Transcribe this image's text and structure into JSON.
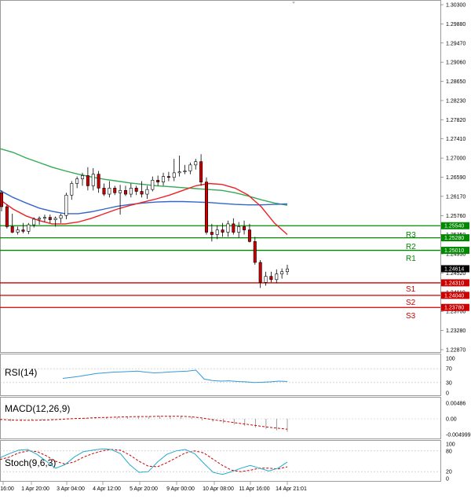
{
  "chart_data": {
    "type": "candlestick",
    "instrument_note": "",
    "colors": {
      "bull": "#ffffff",
      "bear": "#cc0000",
      "wick": "#000000",
      "ma_fast": "#3366cc",
      "ma_slow": "#33aa55",
      "ma_red": "#ee2222",
      "support": "#cc0000",
      "resistance": "#008800",
      "current": "#000000",
      "rsi": "#3399dd",
      "macd": "#cc0000",
      "stoch_main": "#22aacc",
      "stoch_signal": "#cc0000"
    },
    "price_axis": {
      "min": 1.2287,
      "max": 1.303,
      "labels": [
        "1.30300",
        "1.29880",
        "1.29470",
        "1.29060",
        "1.28650",
        "1.28230",
        "1.27820",
        "1.27410",
        "1.27000",
        "1.26590",
        "1.26170",
        "1.25760",
        "1.25350",
        "1.24930",
        "1.24520",
        "1.24110",
        "1.23700",
        "1.23280",
        "1.22870"
      ]
    },
    "time_axis": {
      "labels": [
        "16:00",
        "1 Apr 20:00",
        "3 Apr 04:00",
        "4 Apr 12:00",
        "5 Apr 20:00",
        "9 Apr 00:00",
        "10 Apr 08:00",
        "11 Apr 16:00",
        "14 Apr 21:01"
      ]
    },
    "candles": [
      [
        1.2625,
        1.263,
        1.2585,
        1.2595
      ],
      [
        1.2595,
        1.26,
        1.2548,
        1.2552
      ],
      [
        1.2552,
        1.258,
        1.2538,
        1.254
      ],
      [
        1.254,
        1.2552,
        1.2535,
        1.2545
      ],
      [
        1.2545,
        1.256,
        1.2538,
        1.2542
      ],
      [
        1.2542,
        1.256,
        1.2536,
        1.2556
      ],
      [
        1.2556,
        1.2572,
        1.255,
        1.2568
      ],
      [
        1.2568,
        1.2574,
        1.2556,
        1.257
      ],
      [
        1.257,
        1.2578,
        1.2562,
        1.2572
      ],
      [
        1.2572,
        1.2578,
        1.256,
        1.2567
      ],
      [
        1.2567,
        1.2574,
        1.2552,
        1.257
      ],
      [
        1.257,
        1.258,
        1.256,
        1.2576
      ],
      [
        1.2576,
        1.2625,
        1.2568,
        1.262
      ],
      [
        1.262,
        1.265,
        1.261,
        1.2645
      ],
      [
        1.2645,
        1.266,
        1.2635,
        1.2655
      ],
      [
        1.2655,
        1.2668,
        1.264,
        1.2662
      ],
      [
        1.2662,
        1.268,
        1.263,
        1.264
      ],
      [
        1.264,
        1.2678,
        1.263,
        1.2665
      ],
      [
        1.2665,
        1.2672,
        1.2625,
        1.2635
      ],
      [
        1.2635,
        1.2645,
        1.2618,
        1.2622
      ],
      [
        1.2622,
        1.265,
        1.2615,
        1.2635
      ],
      [
        1.2635,
        1.264,
        1.262,
        1.2625
      ],
      [
        1.2625,
        1.2642,
        1.2578,
        1.263
      ],
      [
        1.263,
        1.264,
        1.2618,
        1.2622
      ],
      [
        1.2622,
        1.2645,
        1.2615,
        1.2635
      ],
      [
        1.2635,
        1.264,
        1.262,
        1.2628
      ],
      [
        1.2628,
        1.265,
        1.2615,
        1.2622
      ],
      [
        1.2622,
        1.264,
        1.2612,
        1.2632
      ],
      [
        1.2632,
        1.266,
        1.2628,
        1.2652
      ],
      [
        1.2652,
        1.2662,
        1.264,
        1.2648
      ],
      [
        1.2648,
        1.2668,
        1.264,
        1.266
      ],
      [
        1.266,
        1.267,
        1.265,
        1.2658
      ],
      [
        1.2658,
        1.2698,
        1.265,
        1.2668
      ],
      [
        1.2668,
        1.2705,
        1.266,
        1.267
      ],
      [
        1.267,
        1.2685,
        1.2665,
        1.2672
      ],
      [
        1.2672,
        1.269,
        1.2665,
        1.2685
      ],
      [
        1.2685,
        1.2698,
        1.2675,
        1.2692
      ],
      [
        1.2692,
        1.2708,
        1.264,
        1.2648
      ],
      [
        1.2648,
        1.2658,
        1.2535,
        1.254
      ],
      [
        1.254,
        1.2558,
        1.252,
        1.2535
      ],
      [
        1.2535,
        1.2555,
        1.2525,
        1.2545
      ],
      [
        1.2545,
        1.256,
        1.253,
        1.254
      ],
      [
        1.254,
        1.2565,
        1.253,
        1.2558
      ],
      [
        1.2558,
        1.257,
        1.2535,
        1.254
      ],
      [
        1.254,
        1.2562,
        1.2528,
        1.2552
      ],
      [
        1.2552,
        1.2565,
        1.2535,
        1.2545
      ],
      [
        1.2545,
        1.2558,
        1.2518,
        1.252
      ],
      [
        1.252,
        1.253,
        1.247,
        1.2475
      ],
      [
        1.2475,
        1.248,
        1.242,
        1.2432
      ],
      [
        1.2432,
        1.2455,
        1.2425,
        1.2445
      ],
      [
        1.2445,
        1.2455,
        1.2432,
        1.2438
      ],
      [
        1.2438,
        1.246,
        1.243,
        1.245
      ],
      [
        1.245,
        1.2462,
        1.244,
        1.2455
      ],
      [
        1.2455,
        1.247,
        1.2448,
        1.2461
      ]
    ],
    "ma_fast": [
      1.263,
      1.2615,
      1.2603,
      1.2592,
      1.2585,
      1.258,
      1.258,
      1.2584,
      1.259,
      1.2596,
      1.26,
      1.2603,
      1.2605,
      1.2606,
      1.2606,
      1.2605,
      1.2604,
      1.2602,
      1.26,
      1.2599,
      1.2599,
      1.26,
      1.2601
    ],
    "ma_slow": [
      1.272,
      1.2712,
      1.27,
      1.269,
      1.268,
      1.2672,
      1.2665,
      1.2659,
      1.2654,
      1.265,
      1.2646,
      1.2643,
      1.264,
      1.2638,
      1.2636,
      1.2634,
      1.2632,
      1.263,
      1.2625,
      1.2618,
      1.261,
      1.2603,
      1.2598
    ],
    "ma_red": [
      1.261,
      1.259,
      1.2575,
      1.2565,
      1.2558,
      1.2558,
      1.2562,
      1.257,
      1.258,
      1.259,
      1.2598,
      1.2605,
      1.2612,
      1.262,
      1.263,
      1.264,
      1.2645,
      1.2643,
      1.2635,
      1.262,
      1.2595,
      1.256,
      1.2535
    ],
    "levels": [
      {
        "name": "R3",
        "value": 1.2554,
        "type": "resistance",
        "label": "1.25540",
        "show_name": false
      },
      {
        "name": "R3",
        "value": 1.2528,
        "type": "resistance",
        "label": "1.25280",
        "show_name": true
      },
      {
        "name": "R2",
        "value": 1.2501,
        "type": "resistance",
        "label": "1.25010",
        "show_name": true
      },
      {
        "name": "S1",
        "value": 1.2431,
        "type": "support",
        "label": "1.24310",
        "show_name": true
      },
      {
        "name": "S2",
        "value": 1.2404,
        "type": "support",
        "label": "1.24040",
        "show_name": true
      },
      {
        "name": "S3",
        "value": 1.2378,
        "type": "support",
        "label": "1.23780",
        "show_name": true
      }
    ],
    "level_names": [
      "R3",
      "R2",
      "R1",
      "S1",
      "S2",
      "S3"
    ],
    "current_price": {
      "value": 1.24614,
      "label": "1.24614"
    },
    "indicators": [
      {
        "key": "rsi",
        "title": "RSI(14)",
        "min": 0,
        "max": 100,
        "ticks": [
          "100",
          "70",
          "30",
          "0"
        ],
        "ref_lines": [
          70,
          30
        ],
        "values": [
          42,
          45,
          48,
          52,
          56,
          58,
          60,
          61,
          62,
          63,
          60,
          58,
          59,
          61,
          62,
          63,
          66,
          40,
          36,
          34,
          35,
          33,
          32,
          30,
          31,
          32,
          34,
          33
        ]
      },
      {
        "key": "macd",
        "title": "MACD(12,26,9)",
        "min": -0.006,
        "max": 0.006,
        "ticks": [
          "0.00486",
          "0.00",
          "-0.004999"
        ],
        "ref_lines": [
          0
        ],
        "hist": [
          -0.001,
          -0.0009,
          -0.0008,
          -0.0006,
          -0.0005,
          -0.0004,
          -0.0002,
          0.0,
          0.0002,
          0.0004,
          0.0005,
          0.0006,
          0.0007,
          0.0008,
          0.0009,
          0.001,
          0.001,
          0.0009,
          0.0008,
          -0.0005,
          -0.001,
          -0.0015,
          -0.002,
          -0.0025,
          -0.003,
          -0.0035,
          -0.004,
          -0.0045
        ],
        "signal": [
          -0.0002,
          -0.0004,
          -0.0005,
          -0.0005,
          -0.0004,
          -0.0003,
          -0.0001,
          0.0001,
          0.0002,
          0.0004,
          0.0005,
          0.0006,
          0.0007,
          0.0008,
          0.0008,
          0.0009,
          0.0009,
          0.0009,
          0.0007,
          0.0003,
          -0.0003,
          -0.0008,
          -0.0013,
          -0.0018,
          -0.0023,
          -0.0028,
          -0.0032,
          -0.0036
        ]
      },
      {
        "key": "stoch",
        "title": "Stoch(9,6,3)",
        "min": 0,
        "max": 100,
        "ticks": [
          "100",
          "80",
          "20",
          "0"
        ],
        "ref_lines": [
          80,
          20
        ],
        "main": [
          60,
          72,
          82,
          84,
          70,
          50,
          30,
          40,
          62,
          78,
          82,
          86,
          84,
          72,
          40,
          18,
          20,
          48,
          70,
          80,
          84,
          72,
          44,
          18,
          12,
          20,
          30,
          38,
          30,
          22,
          30,
          48
        ],
        "signal": [
          55,
          62,
          74,
          80,
          78,
          66,
          50,
          42,
          48,
          62,
          72,
          80,
          84,
          82,
          68,
          50,
          36,
          34,
          46,
          60,
          74,
          80,
          74,
          56,
          38,
          24,
          20,
          24,
          30,
          30,
          28,
          34
        ]
      }
    ]
  }
}
